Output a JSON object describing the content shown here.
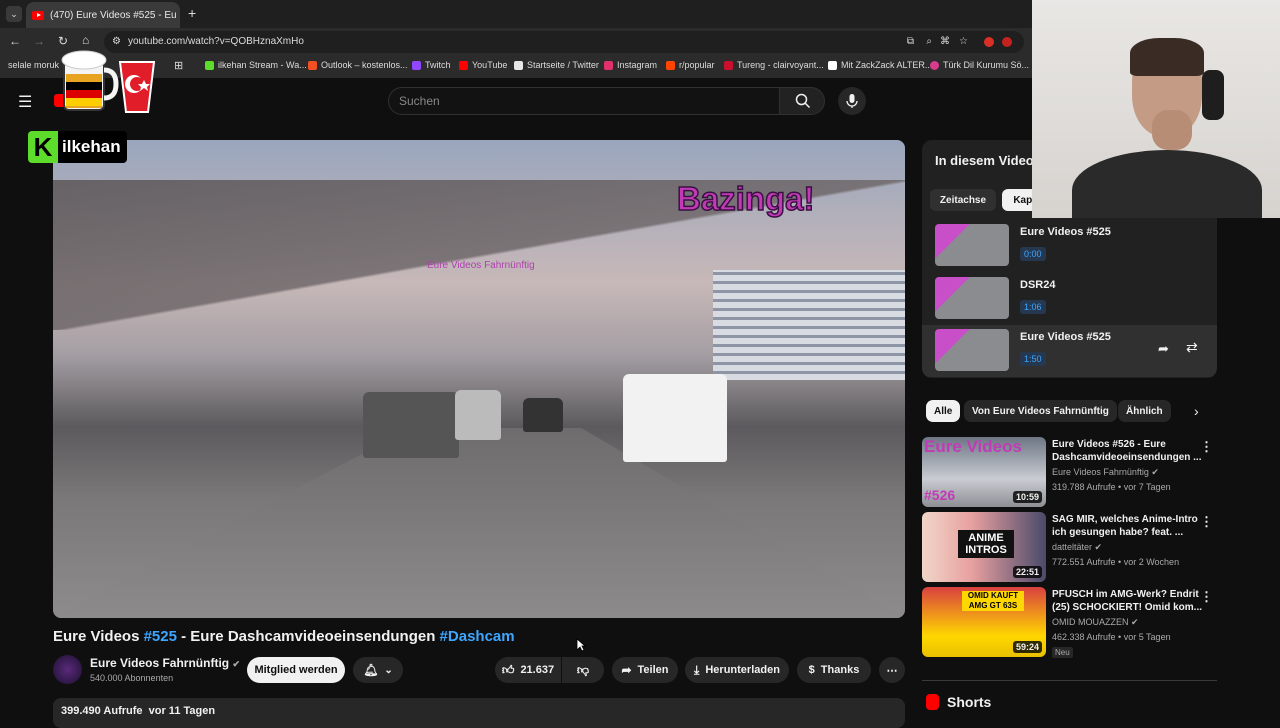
{
  "browser": {
    "tab_count_title": "(470) Eure Videos #525 - Eu",
    "url": "youtube.com/watch?v=QOBHznaXmHo",
    "bookmarks": [
      {
        "label": "selale moruk",
        "color": "#888888"
      },
      {
        "label": "ilkehan Stream - Wa...",
        "color": "#5ddc2c"
      },
      {
        "label": "Outlook – kostenlos...",
        "color": "#f25022"
      },
      {
        "label": "Twitch",
        "color": "#9146ff"
      },
      {
        "label": "YouTube",
        "color": "#ff0000"
      },
      {
        "label": "Startseite / Twitter",
        "color": "#e7e7e7"
      },
      {
        "label": "Instagram",
        "color": "#e1306c"
      },
      {
        "label": "r/popular",
        "color": "#ff4500"
      },
      {
        "label": "Tureng - clairvoyant...",
        "color": "#c8102e"
      },
      {
        "label": "Mit ZackZack ALTER...",
        "color": "#ffffff"
      },
      {
        "label": "Türk Dil Kurumu Sö...",
        "color": "#d83a8c"
      }
    ]
  },
  "header": {
    "search_placeholder": "Suchen"
  },
  "overlay": {
    "streamer_name": "ilkehan",
    "streamer_logo_letter": "K"
  },
  "video": {
    "overlay_text": "Bazinga!",
    "watermark": "Eure Videos Fahrnünftig",
    "title_prefix": "Eure Videos ",
    "title_tag1": "#525",
    "title_middle": " - Eure Dashcamvideoeinsendungen ",
    "title_tag2": "#Dashcam"
  },
  "channel": {
    "name": "Eure Videos Fahrnünftig",
    "subscribers": "540.000 Abonnenten",
    "join_label": "Mitglied werden"
  },
  "actions": {
    "likes": "21.637",
    "share": "Teilen",
    "download": "Herunterladen",
    "thanks": "Thanks"
  },
  "description": {
    "stats": "399.490 Aufrufe  vor 11 Tagen"
  },
  "chapters": {
    "title": "In diesem Video",
    "tabs": [
      "Zeitachse",
      "Kapitel"
    ],
    "items": [
      {
        "name": "Eure Videos #525",
        "time": "0:00"
      },
      {
        "name": "DSR24",
        "time": "1:06"
      },
      {
        "name": "Eure Videos #525",
        "time": "1:50"
      }
    ]
  },
  "filters": [
    "Alle",
    "Von Eure Videos Fahrnünftig",
    "Ähnlich"
  ],
  "recommendations": [
    {
      "title": "Eure Videos #526 - Eure Dashcamvideoeinsendungen ...",
      "channel": "Eure Videos Fahrnünftig",
      "meta": "319.788 Aufrufe • vor 7 Tagen",
      "duration": "10:59",
      "thumb_text": "Eure Videos",
      "thumb_tag": "#526"
    },
    {
      "title": "SAG MIR, welches Anime-Intro ich gesungen habe? feat. ...",
      "channel": "datteltäter",
      "meta": "772.551 Aufrufe • vor 2 Wochen",
      "duration": "22:51",
      "thumb_text": "ANIME INTROS"
    },
    {
      "title": "PFUSCH im AMG-Werk? Endrit (25) SCHOCKIERT! Omid kom...",
      "channel": "OMID MOUAZZEN",
      "meta": "462.338 Aufrufe • vor 5 Tagen",
      "duration": "59:24",
      "thumb_text": "OMID KAUFT AMG GT 63S",
      "badge": "Neu"
    }
  ],
  "shorts_label": "Shorts",
  "colors": {
    "background": "#0f0f0f",
    "link_blue": "#3ea6ff",
    "youtube_red": "#ff0000",
    "overlay_magenta": "#c23ab8"
  }
}
